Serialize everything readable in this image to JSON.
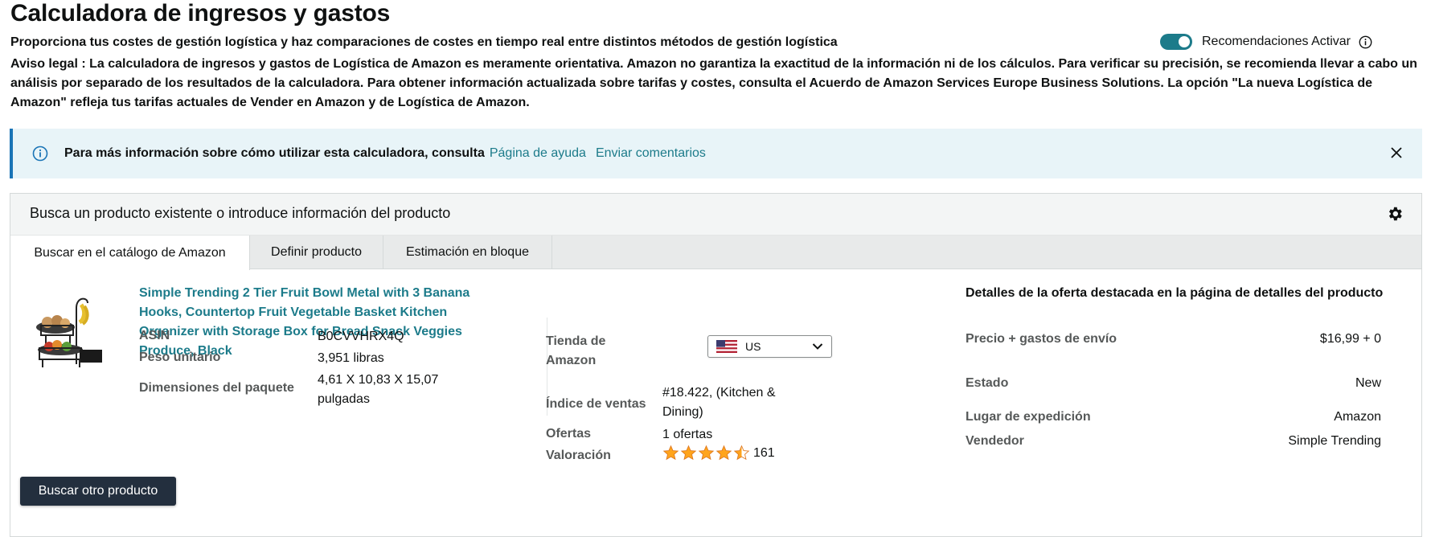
{
  "header": {
    "title": "Calculadora de ingresos y gastos",
    "subtitle": "Proporciona tus costes de gestión logística y haz comparaciones de costes en tiempo real entre distintos métodos de gestión logística",
    "legal_label": "Aviso legal",
    "legal_text": " : La calculadora de ingresos y gastos de Logística de Amazon es meramente orientativa. Amazon no garantiza la exactitud de la información ni de los cálculos. Para verificar su precisión, se recomienda llevar a cabo un análisis por separado de los resultados de la calculadora. Para obtener información actualizada sobre tarifas y costes, consulta el Acuerdo de Amazon Services Europe Business Solutions. La opción \"La nueva Logística de Amazon\" refleja tus tarifas actuales de Vender en Amazon y de Logística de Amazon.",
    "recommendations_label": "Recomendaciones Activar",
    "recommendations_on": true
  },
  "banner": {
    "text": "Para más información sobre cómo utilizar esta calculadora, consulta",
    "help_link": "Página de ayuda",
    "feedback_link": "Enviar comentarios"
  },
  "panel": {
    "title": "Busca un producto existente o introduce información del producto",
    "tabs": [
      {
        "label": "Buscar en el catálogo de Amazon",
        "active": true
      },
      {
        "label": "Definir producto",
        "active": false
      },
      {
        "label": "Estimación en bloque",
        "active": false
      }
    ]
  },
  "product": {
    "title": "Simple Trending 2 Tier Fruit Bowl Metal with 3 Banana Hooks, Countertop Fruit Vegetable Basket Kitchen Organizer with Storage Box for Bread Snack Veggies Produce, Black",
    "asin_label": "ASIN",
    "asin": "B0CVVHRX4Q",
    "weight_label": "Peso unitario",
    "weight": "3,951 libras",
    "dims_label": "Dimensiones del paquete",
    "dims": "4,61 X 10,83 X 15,07 pulgadas"
  },
  "store": {
    "store_label": "Tienda de Amazon",
    "store_value": "US",
    "rank_label": "Índice de ventas",
    "rank_value": "#18.422, (Kitchen & Dining)",
    "offers_label": "Ofertas",
    "offers_value": "1 ofertas",
    "rating_label": "Valoración",
    "rating_stars": 4.5,
    "rating_count": "161"
  },
  "offer": {
    "heading": "Detalles de la oferta destacada en la página de detalles del producto",
    "price_label": "Precio + gastos de envío",
    "price_value": "$16,99 + 0",
    "condition_label": "Estado",
    "condition_value": "New",
    "ship_label": "Lugar de expedición",
    "ship_value": "Amazon",
    "seller_label": "Vendedor",
    "seller_value": "Simple Trending"
  },
  "actions": {
    "search_other": "Buscar otro producto"
  },
  "colors": {
    "accent": "#1c7b8a",
    "banner_bg": "#e8f4f8",
    "button_bg": "#232f3e",
    "star": "#ffa41c"
  }
}
